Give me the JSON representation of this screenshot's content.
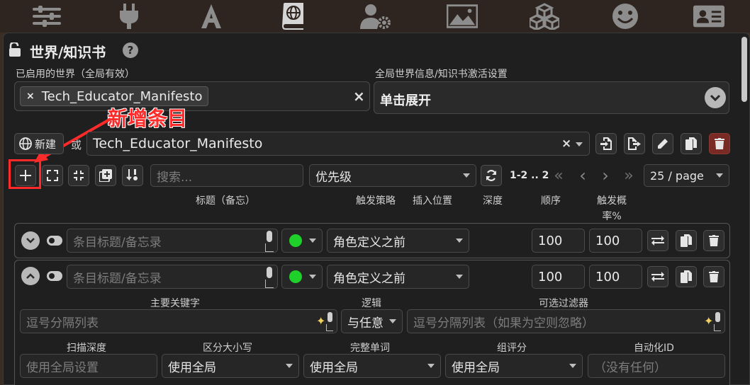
{
  "top_nav": {
    "icons": [
      "sliders-icon",
      "plug-icon",
      "font-icon",
      "world-book-icon",
      "user-gear-icon",
      "image-icon",
      "cubes-icon",
      "smiley-icon",
      "id-card-icon"
    ]
  },
  "panel": {
    "title": "世界/知识书",
    "help": "?"
  },
  "active_worlds": {
    "label": "已启用的世界（全局有效）",
    "chip": "Tech_Educator_Manifesto",
    "chip_remove": "×",
    "clear": "×"
  },
  "global_settings": {
    "label": "全局世界信息/知识书激活设置",
    "value": "单击展开"
  },
  "annotation": {
    "text": "新增条目"
  },
  "world_picker": {
    "new_label": "新建",
    "or_label": "或",
    "selected": "Tech_Educator_Manifesto",
    "clear": "×"
  },
  "entry_toolbar": {
    "search_placeholder": "搜索...",
    "sort_value": "优先级",
    "page_range": "1-2 .. 2",
    "per_page": "25 / page"
  },
  "columns": {
    "title": "标题（备忘）",
    "strategy": "触发策略",
    "position": "插入位置",
    "depth": "深度",
    "order": "顺序",
    "probability": "触发概率%"
  },
  "entries": [
    {
      "title_placeholder": "条目标题/备忘录",
      "position": "角色定义之前",
      "order": "100",
      "probability": "100",
      "expanded": false
    },
    {
      "title_placeholder": "条目标题/备忘录",
      "position": "角色定义之前",
      "order": "100",
      "probability": "100",
      "expanded": true
    }
  ],
  "entry_detail": {
    "primary_keywords_label": "主要关键字",
    "primary_keywords_placeholder": "逗号分隔列表",
    "logic_label": "逻辑",
    "logic_value": "与任意",
    "filters_label": "可选过滤器",
    "filters_placeholder": "逗号分隔列表（如果为空则忽略）",
    "scan_depth_label": "扫描深度",
    "scan_depth_placeholder": "使用全局设置",
    "case_label": "区分大小写",
    "case_value": "使用全局",
    "whole_word_label": "完整单词",
    "whole_word_value": "使用全局",
    "group_score_label": "组评分",
    "group_score_value": "使用全局",
    "automation_label": "自动化ID",
    "automation_placeholder": "（没有任何）"
  },
  "colors": {
    "annotation": "#ff2a2a",
    "trigger_green": "#1fcf2a",
    "delete_red": "#7a2a24"
  }
}
